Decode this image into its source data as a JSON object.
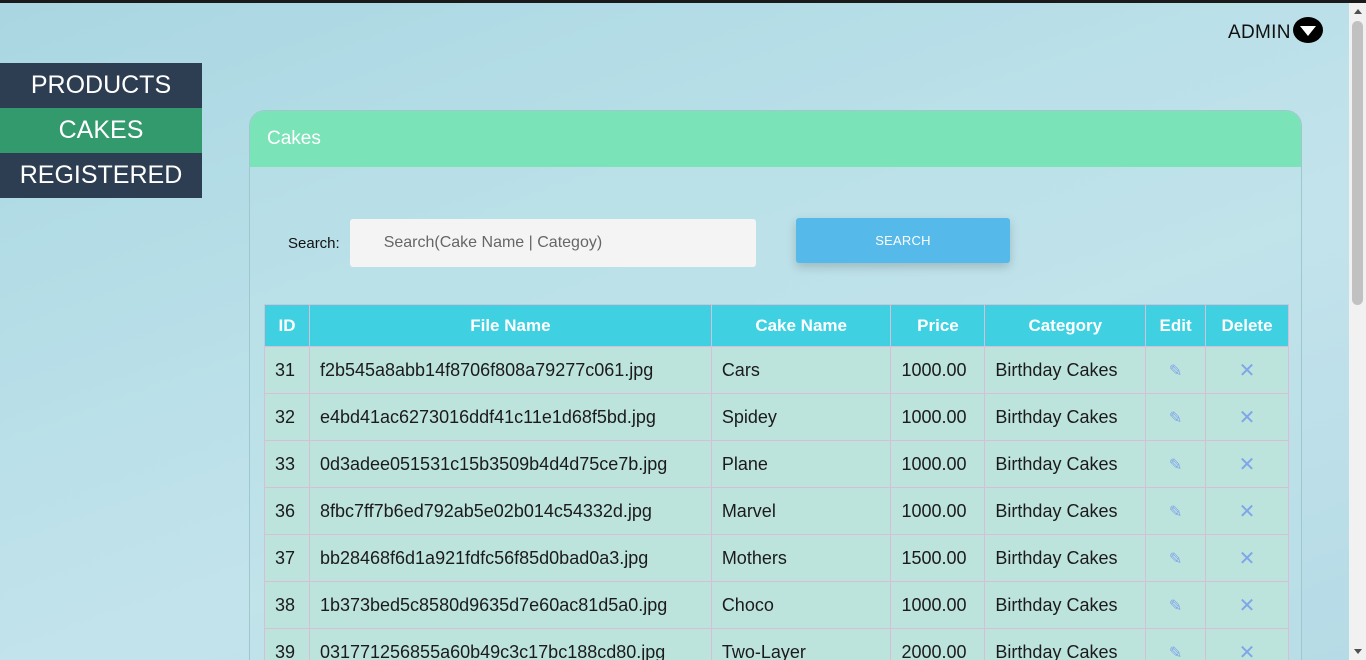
{
  "header": {
    "user_label": "ADMIN",
    "user_menu_icon": "caret-down-icon"
  },
  "sidebar": {
    "items": [
      {
        "label": "PRODUCTS",
        "active": false
      },
      {
        "label": "CAKES",
        "active": true
      },
      {
        "label": "REGISTERED",
        "active": false
      }
    ]
  },
  "panel": {
    "title": "Cakes",
    "search_label": "Search:",
    "search_placeholder": "Search(Cake Name | Categoy)",
    "search_value": "",
    "search_button": "SEARCH"
  },
  "table": {
    "columns": [
      "ID",
      "File Name",
      "Cake Name",
      "Price",
      "Category",
      "Edit",
      "Delete"
    ],
    "rows": [
      {
        "id": "31",
        "file": "f2b545a8abb14f8706f808a79277c061.jpg",
        "name": "Cars",
        "price": "1000.00",
        "category": "Birthday Cakes"
      },
      {
        "id": "32",
        "file": "e4bd41ac6273016ddf41c11e1d68f5bd.jpg",
        "name": "Spidey",
        "price": "1000.00",
        "category": "Birthday Cakes"
      },
      {
        "id": "33",
        "file": "0d3adee051531c15b3509b4d4d75ce7b.jpg",
        "name": "Plane",
        "price": "1000.00",
        "category": "Birthday Cakes"
      },
      {
        "id": "36",
        "file": "8fbc7ff7b6ed792ab5e02b014c54332d.jpg",
        "name": "Marvel",
        "price": "1000.00",
        "category": "Birthday Cakes"
      },
      {
        "id": "37",
        "file": "bb28468f6d1a921fdfc56f85d0bad0a3.jpg",
        "name": "Mothers",
        "price": "1500.00",
        "category": "Birthday Cakes"
      },
      {
        "id": "38",
        "file": "1b373bed5c8580d9635d7e60ac81d5a0.jpg",
        "name": "Choco",
        "price": "1000.00",
        "category": "Birthday Cakes"
      },
      {
        "id": "39",
        "file": "031771256855a60b49c3c17bc188cd80.jpg",
        "name": "Two-Layer",
        "price": "2000.00",
        "category": "Birthday Cakes"
      }
    ],
    "edit_icon": "pencil-icon",
    "delete_icon": "close-icon"
  },
  "colors": {
    "sidebar_bg": "#2e3e52",
    "sidebar_active": "#339a6d",
    "panel_header": "#7be3b8",
    "table_header": "#3fd1e1",
    "search_button": "#55b9ea"
  }
}
